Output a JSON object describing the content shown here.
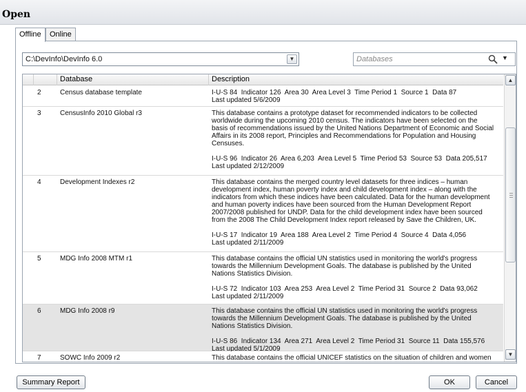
{
  "window": {
    "title": "Open"
  },
  "tabs": [
    {
      "label": "Offline",
      "active": true
    },
    {
      "label": "Online",
      "active": false
    }
  ],
  "path_combo": {
    "value": "C:\\DevInfo\\DevInfo 6.0"
  },
  "search": {
    "placeholder": "Databases",
    "icon": "search-icon"
  },
  "table": {
    "columns": [
      "",
      "Database",
      "Description"
    ],
    "rows": [
      {
        "num": "2",
        "name": "Census database template",
        "description": "I-U-S 84  Indicator 126  Area 30  Area Level 3  Time Period 1  Source 1  Data 87\nLast updated 5/6/2009"
      },
      {
        "num": "3",
        "name": "CensusInfo 2010 Global r3",
        "description": "This database contains a prototype dataset for recommended indicators to be collected\nworldwide during the upcoming 2010 census. The indicators have been selected on the\nbasis of recommendations issued by the United Nations Department of Economic and Social\nAffairs in its 2008 report, Principles and Recommendations for Population and Housing\nCensuses.\n\nI-U-S 96  Indicator 26  Area 6,203  Area Level 5  Time Period 53  Source 53  Data 205,517\nLast updated 2/12/2009"
      },
      {
        "num": "4",
        "name": "Development Indexes r2",
        "description": "This database contains the merged country level datasets for three indices – human\ndevelopment index, human poverty index and child development index – along with the\nindicators from which these indices have been calculated. Data for the human development\nand human poverty indices have been sourced from the Human Development Report\n2007/2008 published for UNDP. Data for the child development index have been sourced\nfrom the 2008 The Child Development Index report released by Save the Children, UK.\n\nI-U-S 17  Indicator 19  Area 188  Area Level 2  Time Period 4  Source 4  Data 4,056\nLast updated 2/11/2009"
      },
      {
        "num": "5",
        "name": "MDG Info 2008 MTM r1",
        "description": "This database contains the official UN statistics used in monitoring the world's progress\ntowards the Millennium Development Goals. The database is published by the United\nNations Statistics Division.\n\nI-U-S 72  Indicator 103  Area 253  Area Level 2  Time Period 31  Source 2  Data 93,062\nLast updated 2/11/2009"
      },
      {
        "num": "6",
        "name": "MDG Info 2008 r9",
        "selected": true,
        "description": "This database contains the official UN statistics used in monitoring the world's progress\ntowards the Millennium Development Goals. The database is published by the United\nNations Statistics Division.\n\nI-U-S 86  Indicator 134  Area 271  Area Level 2  Time Period 31  Source 11  Data 155,576\nLast updated 5/1/2009"
      },
      {
        "num": "7",
        "name": "SOWC Info 2009 r2",
        "description": "This database contains the official UNICEF statistics on the situation of children and women"
      }
    ]
  },
  "buttons": {
    "summary_report": "Summary Report",
    "ok": "OK",
    "cancel": "Cancel"
  },
  "colors": {
    "selected_row": "#e4e4e4",
    "panel_border": "#9aa4b0"
  }
}
